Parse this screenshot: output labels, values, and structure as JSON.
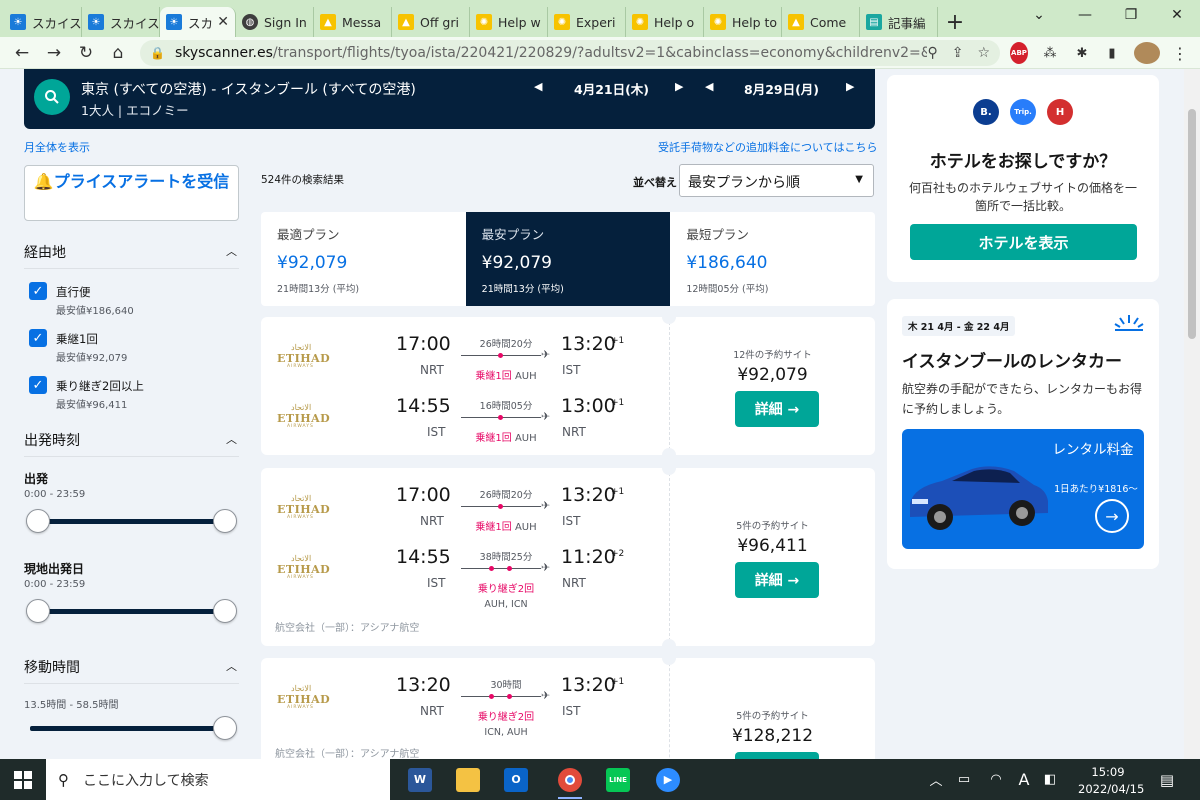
{
  "browser": {
    "tabs": [
      {
        "title": "スカイス",
        "icon": "skyscanner-icon",
        "active": false
      },
      {
        "title": "スカイス",
        "icon": "skyscanner-icon",
        "active": false
      },
      {
        "title": "スカ",
        "icon": "skyscanner-icon",
        "active": true
      },
      {
        "title": "Sign In",
        "icon": "globe-icon",
        "active": false
      },
      {
        "title": "Messa",
        "icon": "tent-icon",
        "active": false
      },
      {
        "title": "Off gri",
        "icon": "tent-icon",
        "active": false
      },
      {
        "title": "Help w",
        "icon": "sun-icon",
        "active": false
      },
      {
        "title": "Experi",
        "icon": "sun-icon",
        "active": false
      },
      {
        "title": "Help o",
        "icon": "sun-icon",
        "active": false
      },
      {
        "title": "Help to",
        "icon": "sun-icon",
        "active": false
      },
      {
        "title": "Come",
        "icon": "tent-icon",
        "active": false
      },
      {
        "title": "記事編",
        "icon": "document-icon",
        "active": false
      }
    ],
    "url_host": "skyscanner.es",
    "url_path": "/transport/flights/tyoa/ista/220421/220829/?adultsv2=1&cabinclass=economy&childrenv2=&inboun..."
  },
  "search": {
    "route": "東京 (すべての空港) - イスタンブール (すべての空港)",
    "pax": "1大人 | エコノミー",
    "depart_date": "4月21日(木)",
    "return_date": "8月29日(月)"
  },
  "links": {
    "whole_month": "月全体を表示",
    "extra_fees": "受託手荷物などの追加料金についてはこちら"
  },
  "price_alert": {
    "label": "プライスアラートを受信"
  },
  "filters": {
    "stops": {
      "title": "経由地",
      "items": [
        {
          "label": "直行便",
          "sub": "最安値¥186,640"
        },
        {
          "label": "乗継1回",
          "sub": "最安値¥92,079"
        },
        {
          "label": "乗り継ぎ2回以上",
          "sub": "最安値¥96,411"
        }
      ]
    },
    "departure": {
      "title": "出発時刻",
      "outbound": {
        "label": "出発",
        "range": "0:00 - 23:59"
      },
      "return": {
        "label": "現地出発日",
        "range": "0:00 - 23:59"
      }
    },
    "duration": {
      "title": "移動時間",
      "range": "13.5時間 - 58.5時間"
    }
  },
  "results": {
    "count": "524件の検索結果",
    "sort_label": "並べ替え",
    "sort_value": "最安プランから順",
    "sort_tabs": [
      {
        "title": "最適プラン",
        "price": "¥92,079",
        "duration": "21時間13分 (平均)"
      },
      {
        "title": "最安プラン",
        "price": "¥92,079",
        "duration": "21時間13分 (平均)"
      },
      {
        "title": "最短プラン",
        "price": "¥186,640",
        "duration": "12時間05分 (平均)"
      }
    ],
    "cards": [
      {
        "legs": [
          {
            "dep": "17:00",
            "dep_code": "NRT",
            "arr": "13:20",
            "arr_offset": "+1",
            "arr_code": "IST",
            "duration": "26時間20分",
            "stops": "乗継1回",
            "via": "AUH",
            "via_line": ""
          },
          {
            "dep": "14:55",
            "dep_code": "IST",
            "arr": "13:00",
            "arr_offset": "+1",
            "arr_code": "NRT",
            "duration": "16時間05分",
            "stops": "乗継1回",
            "via": "AUH",
            "via_line": ""
          }
        ],
        "operated": "",
        "sites": "12件の予約サイト",
        "price": "¥92,079",
        "button": "詳細 →"
      },
      {
        "legs": [
          {
            "dep": "17:00",
            "dep_code": "NRT",
            "arr": "13:20",
            "arr_offset": "+1",
            "arr_code": "IST",
            "duration": "26時間20分",
            "stops": "乗継1回",
            "via": "AUH",
            "via_line": ""
          },
          {
            "dep": "14:55",
            "dep_code": "IST",
            "arr": "11:20",
            "arr_offset": "+2",
            "arr_code": "NRT",
            "duration": "38時間25分",
            "stops": "乗り継ぎ2回",
            "via": "",
            "via_line": "AUH, ICN"
          }
        ],
        "operated": "航空会社（一部）：アシアナ航空",
        "sites": "5件の予約サイト",
        "price": "¥96,411",
        "button": "詳細 →"
      },
      {
        "legs": [
          {
            "dep": "13:20",
            "dep_code": "NRT",
            "arr": "13:20",
            "arr_offset": "+1",
            "arr_code": "IST",
            "duration": "30時間",
            "stops": "乗り継ぎ2回",
            "via": "",
            "via_line": "ICN, AUH"
          }
        ],
        "operated": "航空会社（一部）：アシアナ航空",
        "sites": "5件の予約サイト",
        "price": "¥128,212",
        "button": ""
      }
    ],
    "airline_logo": {
      "arabic": "الاتحاد",
      "name": "ETIHAD",
      "sub": "AIRWAYS"
    }
  },
  "hotel_ad": {
    "brands": [
      "B.",
      "Trip.",
      "H"
    ],
    "title": "ホテルをお探しですか？",
    "desc": "何百社ものホテルウェブサイトの価格を一箇所で一括比較。",
    "button": "ホテルを表示"
  },
  "car_ad": {
    "date": "木 21 4月 - 金 22 4月",
    "title": "イスタンブールのレンタカー",
    "desc": "航空券の手配ができたら、レンタカーもお得に予約しましょう。",
    "banner_title": "レンタル料金",
    "banner_sub": "1日あたり¥1816〜"
  },
  "taskbar": {
    "search_placeholder": "ここに入力して検索",
    "time": "15:09",
    "date": "2022/04/15",
    "ime": "A"
  },
  "colors": {
    "brand_navy": "#05203c",
    "accent_teal": "#00a698",
    "link_blue": "#0770e3",
    "stop_pink": "#e70866"
  }
}
